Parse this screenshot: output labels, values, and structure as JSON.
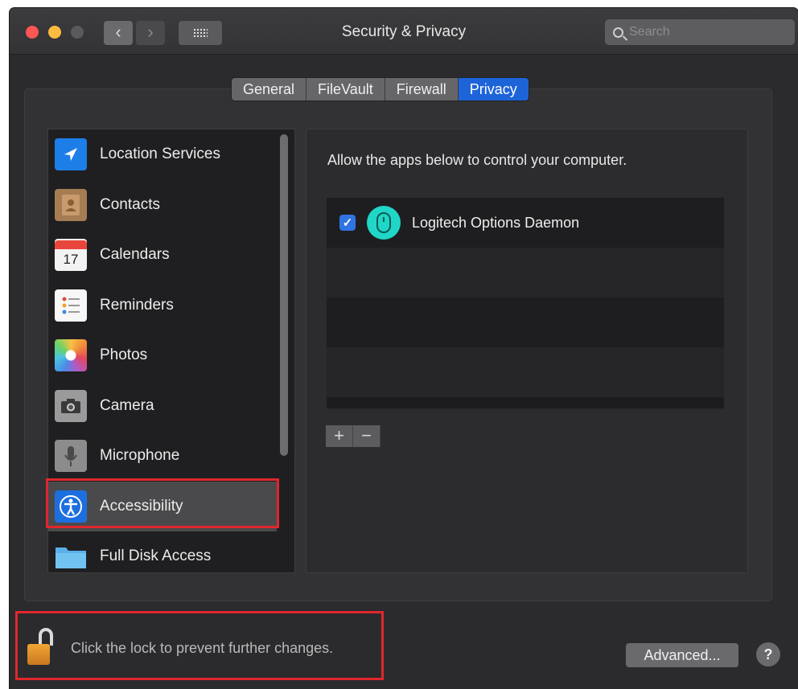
{
  "window": {
    "title": "Security & Privacy"
  },
  "search": {
    "placeholder": "Search"
  },
  "tabs": [
    {
      "label": "General",
      "active": false
    },
    {
      "label": "FileVault",
      "active": false
    },
    {
      "label": "Firewall",
      "active": false
    },
    {
      "label": "Privacy",
      "active": true
    }
  ],
  "sidebar": {
    "items": [
      {
        "label": "Location Services",
        "icon": "location-arrow-icon"
      },
      {
        "label": "Contacts",
        "icon": "contacts-book-icon"
      },
      {
        "label": "Calendars",
        "icon": "calendar-icon",
        "icon_text": "17"
      },
      {
        "label": "Reminders",
        "icon": "reminders-list-icon"
      },
      {
        "label": "Photos",
        "icon": "photos-flower-icon"
      },
      {
        "label": "Camera",
        "icon": "camera-icon"
      },
      {
        "label": "Microphone",
        "icon": "microphone-icon"
      },
      {
        "label": "Accessibility",
        "icon": "accessibility-icon",
        "selected": true
      },
      {
        "label": "Full Disk Access",
        "icon": "folder-icon"
      }
    ]
  },
  "main": {
    "description": "Allow the apps below to control your computer.",
    "apps": [
      {
        "name": "Logitech Options Daemon",
        "checked": true,
        "icon": "logitech-mouse-icon"
      }
    ],
    "add_label": "+",
    "remove_label": "−"
  },
  "footer": {
    "lock_text": "Click the lock to prevent further changes.",
    "advanced_label": "Advanced...",
    "help_label": "?"
  },
  "colors": {
    "accent": "#1d64d9",
    "highlight_box": "#e0272c",
    "app_icon": "#20d6c7"
  }
}
